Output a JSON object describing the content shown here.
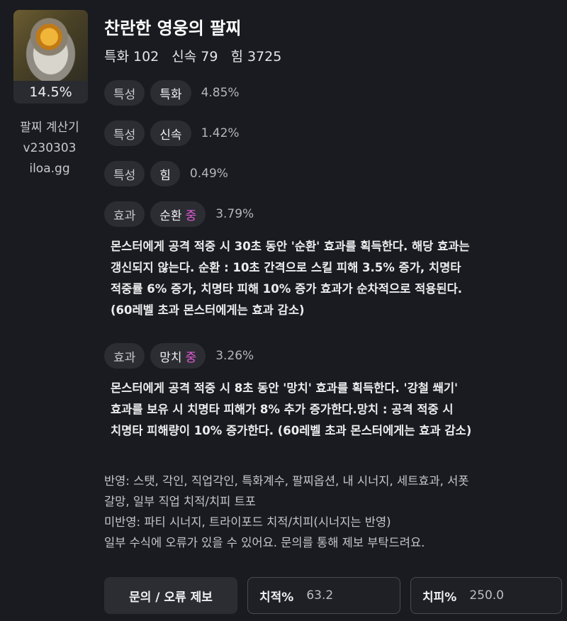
{
  "item": {
    "title": "찬란한 영웅의 팔찌",
    "icon": "bracelet-icon",
    "percent": "14.5%",
    "stats": [
      {
        "label": "특화 102"
      },
      {
        "label": "신속 79"
      },
      {
        "label": "힘 3725"
      }
    ]
  },
  "calculator": {
    "name": "팔찌 계산기",
    "version": "v230303",
    "site": "iloa.gg"
  },
  "options": [
    {
      "type": "특성",
      "name": "특화",
      "grade": "",
      "value": "4.85%"
    },
    {
      "type": "특성",
      "name": "신속",
      "grade": "",
      "value": "1.42%"
    },
    {
      "type": "특성",
      "name": "힘",
      "grade": "",
      "value": "0.49%"
    },
    {
      "type": "효과",
      "name": "순환",
      "grade": "중",
      "value": "3.79%",
      "description": [
        "몬스터에게 공격 적중 시 30초 동안 '순환' 효과를 획득한다. 해당 효과는",
        "갱신되지 않는다. 순환 : 10초 간격으로 스킬 피해 3.5% 증가, 치명타",
        "적중률 6% 증가, 치명타 피해 10% 증가 효과가 순차적으로 적용된다.",
        "(60레벨 초과 몬스터에게는 효과 감소)"
      ]
    },
    {
      "type": "효과",
      "name": "망치",
      "grade": "중",
      "value": "3.26%",
      "description": [
        "몬스터에게 공격 적중 시 8초 동안 '망치' 효과를 획득한다. '강철 쐐기'",
        "효과를 보유 시 치명타 피해가 8% 추가 증가한다.망치 : 공격 적중 시",
        "치명타 피해량이 10% 증가한다. (60레벨 초과 몬스터에게는 효과 감소)"
      ]
    }
  ],
  "grade_color": "#e45bd8",
  "notes": [
    "반영: 스탯, 각인, 직업각인, 특화계수, 팔찌옵션, 내 시너지, 세트효과, 서폿",
    "갈망, 일부 직업 치적/치피 트포",
    "미반영: 파티 시너지, 트라이포드 치적/치피(시너지는 반영)",
    "일부 수식에 오류가 있을 수 있어요. 문의를 통해 제보 부탁드려요."
  ],
  "buttons": {
    "report": "문의 / 오류 제보"
  },
  "inputs": {
    "crit_rate": {
      "label": "치적%",
      "value": "63.2"
    },
    "crit_damage": {
      "label": "치피%",
      "value": "250.0"
    }
  }
}
